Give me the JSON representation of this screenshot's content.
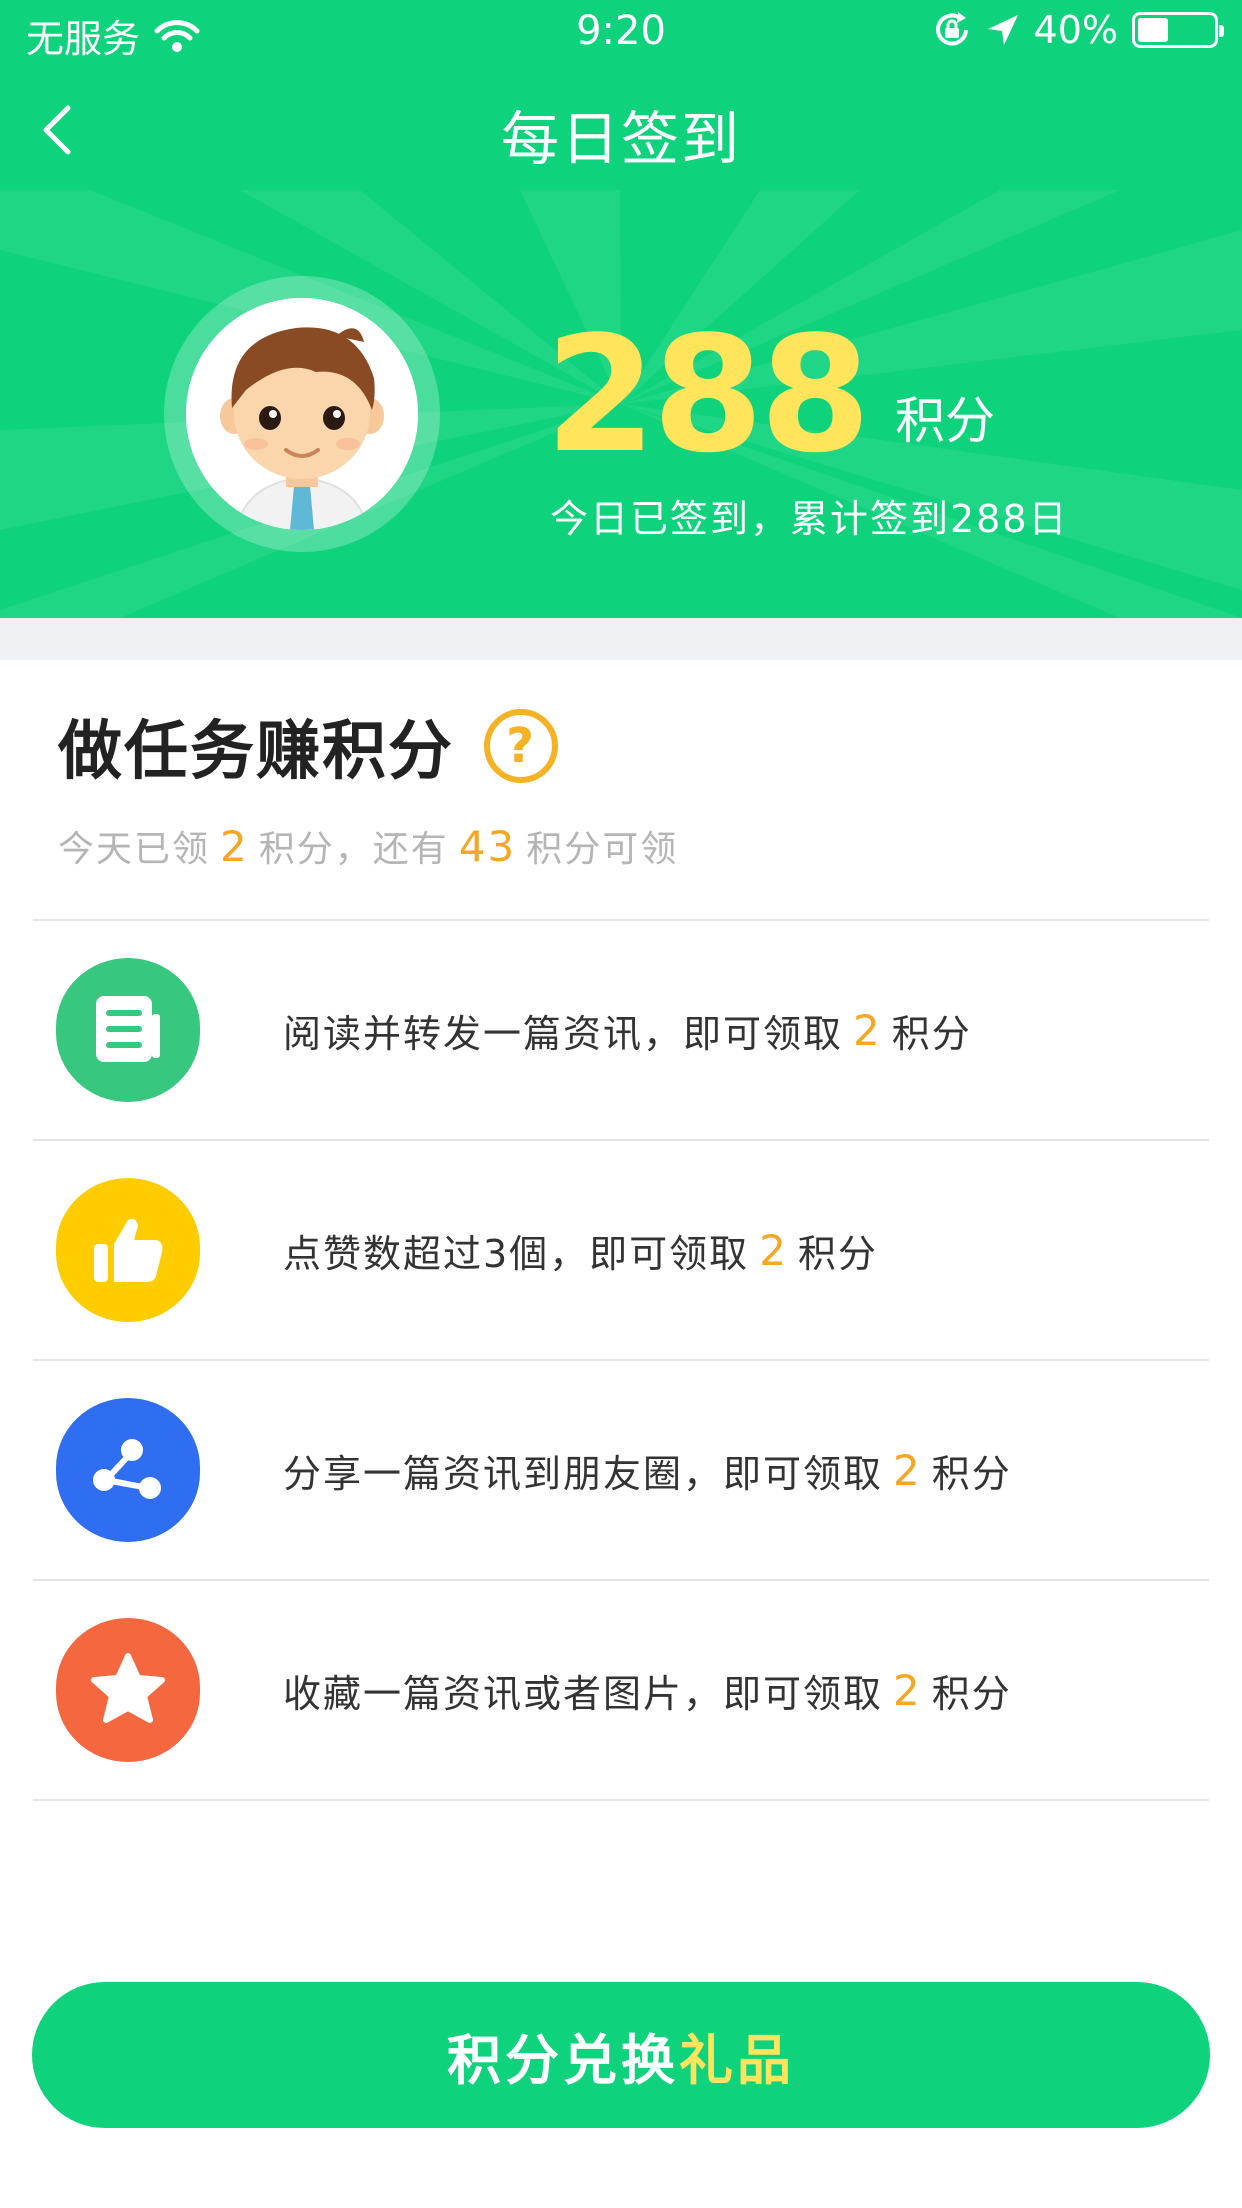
{
  "status_bar": {
    "carrier": "无服务",
    "time": "9:20",
    "battery": "40%",
    "battery_level": 0.4,
    "icons": [
      "wifi-icon",
      "rotation-lock-icon",
      "location-arrow-icon",
      "battery-icon"
    ]
  },
  "nav": {
    "title": "每日签到",
    "back_icon": "chevron-left-icon"
  },
  "profile": {
    "points": "288",
    "points_unit": "积分",
    "checkin_status": "今日已签到，累计签到288日"
  },
  "tasks_section": {
    "title": "做任务赚积分",
    "help_icon": "question-circle-icon",
    "summary_prefix": "今天已领",
    "earned": "2",
    "summary_mid": "积分，还有",
    "remaining": "43",
    "summary_suffix": "积分可领"
  },
  "tasks": [
    {
      "icon": "document-icon",
      "color": "#38c77f",
      "text": "阅读并转发一篇资讯，即可领取",
      "points": "2",
      "unit": "积分"
    },
    {
      "icon": "thumbs-up-icon",
      "color": "#ffcc00",
      "text": "点赞数超过3個，即可领取",
      "points": "2",
      "unit": "积分"
    },
    {
      "icon": "share-icon",
      "color": "#2f6ef0",
      "text": "分享一篇资讯到朋友圈，即可领取",
      "points": "2",
      "unit": "积分"
    },
    {
      "icon": "star-icon",
      "color": "#f5673f",
      "text": "收藏一篇资讯或者图片，即可领取",
      "points": "2",
      "unit": "积分"
    }
  ],
  "exchange_button": {
    "label_part1": "积分兑换",
    "label_part2": "礼品"
  },
  "colors": {
    "brand_green": "#0fd27d",
    "accent_yellow": "#ffe45c",
    "accent_orange": "#f5a623"
  }
}
